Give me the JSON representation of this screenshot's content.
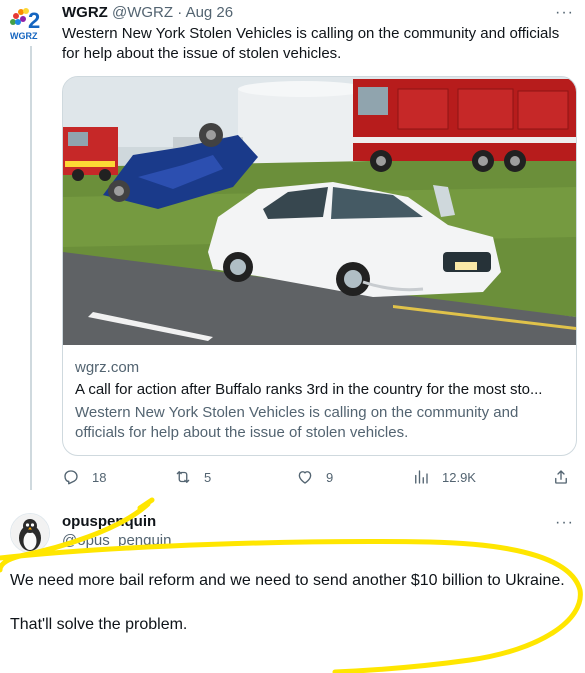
{
  "original_tweet": {
    "avatar": {
      "logo_number": "2",
      "logo_text": "WGRZ"
    },
    "display_name": "WGRZ",
    "handle": "@WGRZ",
    "separator": "·",
    "date": "Aug 26",
    "more_label": "···",
    "text": "Western New York Stolen Vehicles is calling on the community and officials for help about the issue of stolen vehicles.",
    "card": {
      "domain": "wgrz.com",
      "title": "A call for action after Buffalo ranks 3rd in the country for the most sto...",
      "description": "Western New York Stolen Vehicles is calling on the community and officials for help about the issue of stolen vehicles."
    },
    "actions": {
      "replies": "18",
      "retweets": "5",
      "likes": "9",
      "views": "12.9K"
    }
  },
  "reply": {
    "display_name": "opuspenquin",
    "handle": "@opus_penquin",
    "more_label": "···",
    "paragraphs": [
      "We need more bail reform and we need to send another $10 billion to Ukraine.",
      "That'll solve the problem."
    ]
  },
  "colors": {
    "text_primary": "#0f1419",
    "text_secondary": "#536471",
    "border": "#cfd9de",
    "highlight_scribble": "#ffe600",
    "logo_blue": "#1565c0"
  },
  "icons": [
    "reply-icon",
    "retweet-icon",
    "like-icon",
    "views-icon",
    "share-icon",
    "more-icon"
  ]
}
